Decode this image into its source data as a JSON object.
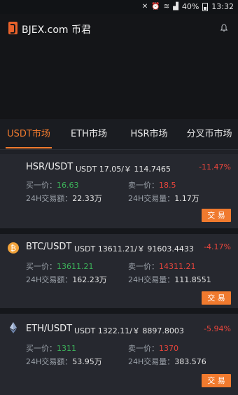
{
  "status": {
    "battery": "40%",
    "time": "13:32"
  },
  "header": {
    "app_title": "BJEX.com  币君"
  },
  "tabs": [
    {
      "label": "USDT市场",
      "active": true
    },
    {
      "label": "ETH市场",
      "active": false
    },
    {
      "label": "HSR市场",
      "active": false
    },
    {
      "label": "分叉币市场",
      "active": false
    }
  ],
  "cards": [
    {
      "icon": "none",
      "pair": "HSR/USDT",
      "quote": "USDT 17.05/￥ 114.7465",
      "change": "-11.47%",
      "buy_label": "买一价：",
      "buy_value": "16.63",
      "sell_label": "卖一价：",
      "sell_value": "18.5",
      "vol_amount_label": "24H交易额：",
      "vol_amount_value": "22.33万",
      "vol_qty_label": "24H交易量：",
      "vol_qty_value": "1.17万",
      "button": "交 易"
    },
    {
      "icon": "bitcoin-icon",
      "pair": "BTC/USDT",
      "quote": "USDT 13611.21/￥ 91603.4433",
      "change": "-4.17%",
      "buy_label": "买一价：",
      "buy_value": "13611.21",
      "sell_label": "卖一价：",
      "sell_value": "14311.21",
      "vol_amount_label": "24H交易额：",
      "vol_amount_value": "162.23万",
      "vol_qty_label": "24H交易量：",
      "vol_qty_value": "111.8551",
      "button": "交 易"
    },
    {
      "icon": "ethereum-icon",
      "pair": "ETH/USDT",
      "quote": "USDT 1322.11/￥ 8897.8003",
      "change": "-5.94%",
      "buy_label": "买一价：",
      "buy_value": "1311",
      "sell_label": "卖一价：",
      "sell_value": "1370",
      "vol_amount_label": "24H交易额：",
      "vol_amount_value": "53.95万",
      "vol_qty_label": "24H交易量：",
      "vol_qty_value": "383.576",
      "button": "交 易"
    }
  ],
  "colors": {
    "accent": "#f07a2e",
    "up": "#3cb45a",
    "down": "#e8453c"
  }
}
